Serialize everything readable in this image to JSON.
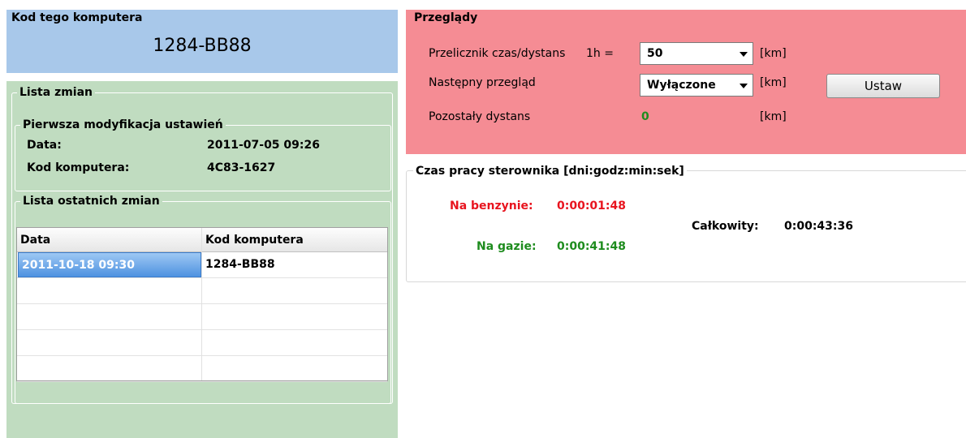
{
  "computer_code": {
    "legend": "Kod tego komputera",
    "code": "1284-BB88"
  },
  "changes": {
    "legend": "Lista zmian",
    "first_mod": {
      "legend": "Pierwsza modyfikacja ustawień",
      "date_label": "Data:",
      "date_value": "2011-07-05 09:26",
      "code_label": "Kod komputera:",
      "code_value": "4C83-1627"
    },
    "recent": {
      "legend": "Lista ostatnich zmian",
      "columns": [
        "Data",
        "Kod komputera"
      ],
      "rows": [
        [
          "2011-10-18 09:30",
          "1284-BB88"
        ]
      ]
    }
  },
  "service": {
    "legend": "Przeglądy",
    "ratio_label": "Przelicznik czas/dystans",
    "ratio_unit_prefix": "1h =",
    "ratio_value": "50",
    "ratio_unit": "[km]",
    "next_label": "Następny przegląd",
    "next_value": "Wyłączone",
    "next_unit": "[km]",
    "set_button": "Ustaw",
    "remaining_label": "Pozostały dystans",
    "remaining_value": "0",
    "remaining_unit": "[km]"
  },
  "runtime": {
    "legend": "Czas pracy sterownika [dni:godz:min:sek]",
    "petrol_label": "Na benzynie:",
    "petrol_value": "0:00:01:48",
    "gas_label": "Na gazie:",
    "gas_value": "0:00:41:48",
    "total_label": "Całkowity:",
    "total_value": "0:00:43:36"
  },
  "colors": {
    "computer_code_bg": "#a8c8ea",
    "changes_bg": "#c0dcc0",
    "service_bg": "#f58c94",
    "petrol": "#e8141e",
    "gas": "#1e8c1e"
  }
}
